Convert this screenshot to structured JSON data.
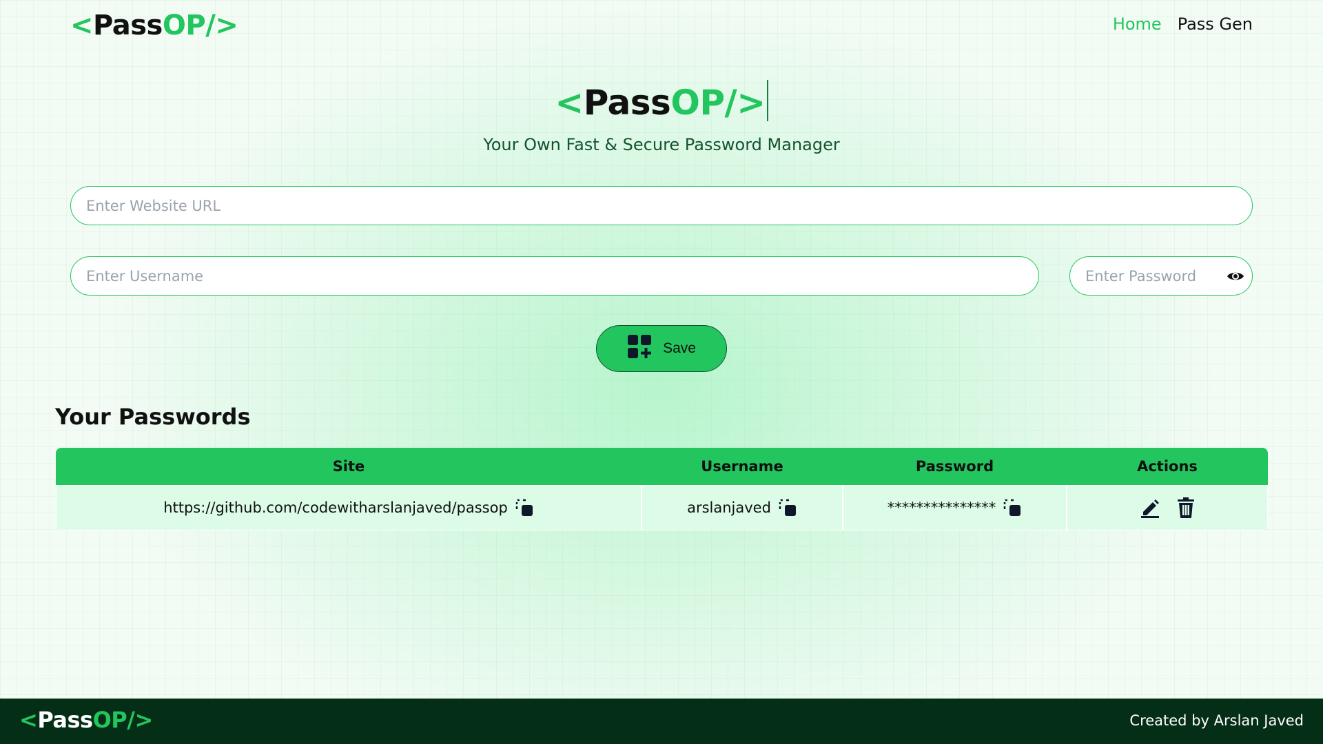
{
  "colors": {
    "accent": "#22c55e",
    "footer_bg": "#052e16",
    "row_bg": "#dcfce7",
    "text": "#111111"
  },
  "nav": {
    "logo": {
      "open": "<",
      "pass": "Pass",
      "op": "OP/",
      "close": ">"
    },
    "links": [
      {
        "label": "Home",
        "active": true
      },
      {
        "label": "Pass Gen",
        "active": false
      }
    ]
  },
  "hero": {
    "logo": {
      "open": "<",
      "pass": "Pass",
      "op": "OP/",
      "close": ">"
    },
    "tagline": "Your Own Fast & Secure Password Manager"
  },
  "form": {
    "url": {
      "placeholder": "Enter Website URL",
      "value": ""
    },
    "username": {
      "placeholder": "Enter Username",
      "value": ""
    },
    "password": {
      "placeholder": "Enter Password",
      "value": "",
      "toggle_icon": "eye-icon"
    },
    "save": {
      "label": "Save",
      "icon": "grid-add-icon"
    }
  },
  "passwords": {
    "title": "Your Passwords",
    "columns": [
      "Site",
      "Username",
      "Password",
      "Actions"
    ],
    "rows": [
      {
        "site": "https://github.com/codewitharslanjaved/passop",
        "username": "arslanjaved",
        "password": "***************",
        "actions": [
          "edit-icon",
          "delete-icon"
        ]
      }
    ]
  },
  "footer": {
    "logo": {
      "open": "<",
      "pass": "Pass",
      "op": "OP/",
      "close": ">"
    },
    "credit": "Created by Arslan Javed"
  }
}
